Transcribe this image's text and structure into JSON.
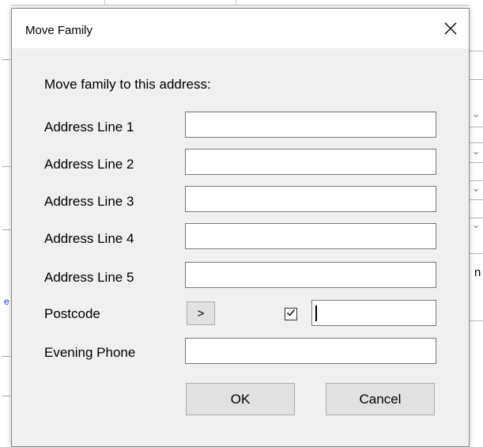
{
  "dialog": {
    "title": "Move Family",
    "intro": "Move family to this address:"
  },
  "fields": [
    {
      "label": "Address Line 1",
      "value": ""
    },
    {
      "label": "Address Line 2",
      "value": ""
    },
    {
      "label": "Address Line 3",
      "value": ""
    },
    {
      "label": "Address Line 4",
      "value": ""
    },
    {
      "label": "Address Line 5",
      "value": ""
    }
  ],
  "postcode": {
    "label": "Postcode",
    "lookup_button": ">",
    "checkbox_checked": true,
    "value": ""
  },
  "evening_phone": {
    "label": "Evening Phone",
    "value": ""
  },
  "buttons": {
    "ok": "OK",
    "cancel": "Cancel"
  },
  "background": {
    "right_fragment": "n",
    "left_fragment": "e"
  },
  "icons": {
    "close": "close-icon",
    "check": "checkmark-icon"
  }
}
